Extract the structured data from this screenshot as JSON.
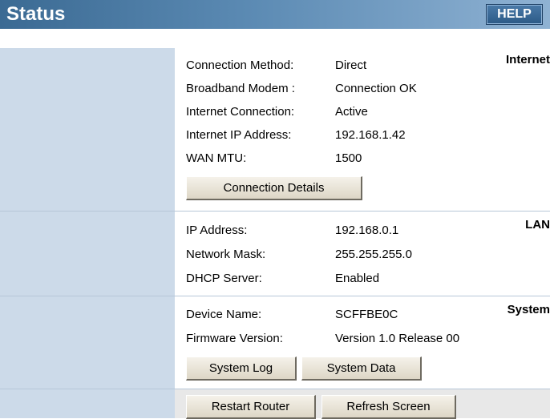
{
  "header": {
    "title": "Status",
    "help_label": "HELP"
  },
  "internet": {
    "label": "Internet",
    "rows": [
      {
        "key": "Connection Method:",
        "value": "Direct"
      },
      {
        "key": "Broadband Modem :",
        "value": "Connection OK"
      },
      {
        "key": "Internet Connection:",
        "value": "Active"
      },
      {
        "key": "Internet IP Address:",
        "value": "192.168.1.42"
      },
      {
        "key": "WAN MTU:",
        "value": "1500"
      }
    ],
    "details_button": "Connection Details"
  },
  "lan": {
    "label": "LAN",
    "rows": [
      {
        "key": "IP Address:",
        "value": "192.168.0.1"
      },
      {
        "key": "Network Mask:",
        "value": "255.255.255.0"
      },
      {
        "key": "DHCP Server:",
        "value": "Enabled"
      }
    ]
  },
  "system": {
    "label": "System",
    "rows": [
      {
        "key": "Device Name:",
        "value": "SCFFBE0C"
      },
      {
        "key": "Firmware Version:",
        "value": "Version 1.0 Release 00"
      }
    ],
    "log_button": "System Log",
    "data_button": "System Data"
  },
  "footer": {
    "restart_button": "Restart Router",
    "refresh_button": "Refresh Screen"
  }
}
